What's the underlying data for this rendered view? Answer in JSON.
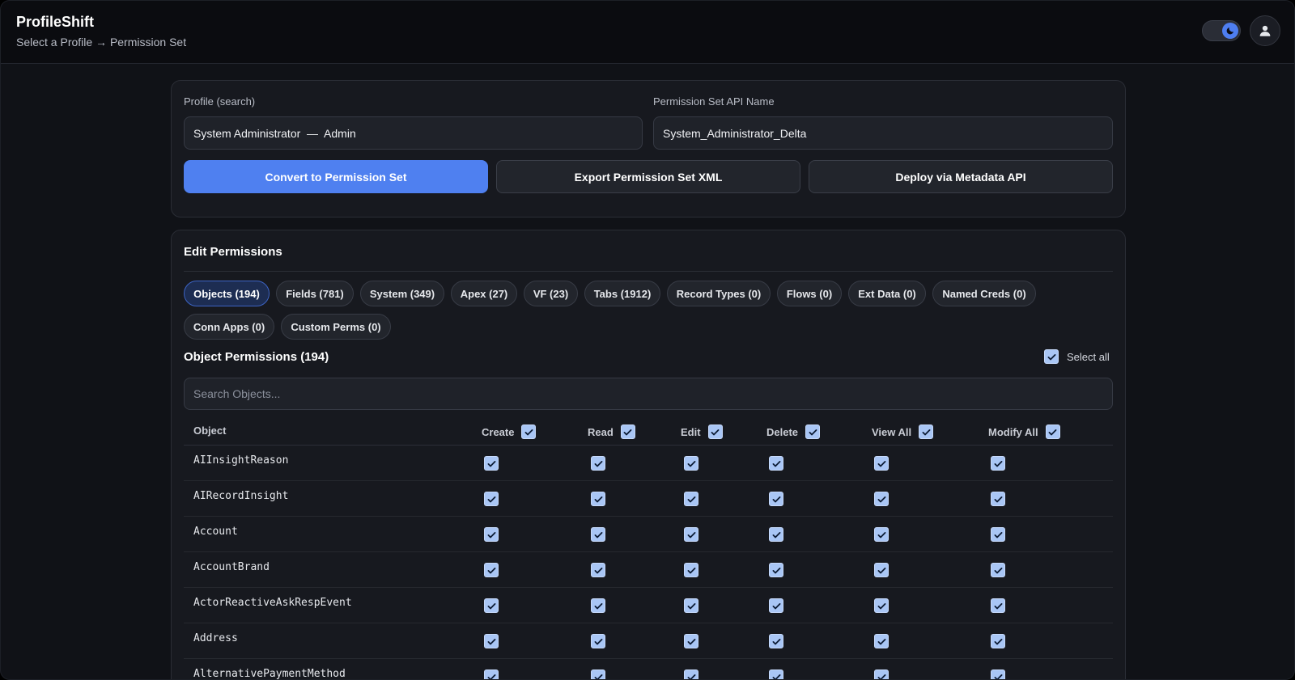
{
  "header": {
    "title": "ProfileShift",
    "subtitle": "Select a Profile → Permission Set"
  },
  "form": {
    "profile_label": "Profile (search)",
    "profile_value": "System Administrator  —  Admin",
    "apiname_label": "Permission Set API Name",
    "apiname_value": "System_Administrator_Delta",
    "convert_label": "Convert to Permission Set",
    "export_label": "Export Permission Set XML",
    "deploy_label": "Deploy via Metadata API"
  },
  "permissions": {
    "title": "Edit Permissions",
    "tabs": [
      {
        "label": "Objects (194)",
        "active": true
      },
      {
        "label": "Fields (781)"
      },
      {
        "label": "System (349)"
      },
      {
        "label": "Apex (27)"
      },
      {
        "label": "VF (23)"
      },
      {
        "label": "Tabs (1912)"
      },
      {
        "label": "Record Types (0)"
      },
      {
        "label": "Flows (0)"
      },
      {
        "label": "Ext Data (0)"
      },
      {
        "label": "Named Creds (0)"
      },
      {
        "label": "Conn Apps (0)"
      },
      {
        "label": "Custom Perms (0)"
      }
    ],
    "object_title": "Object Permissions (194)",
    "select_all_label": "Select all",
    "search_placeholder": "Search Objects...",
    "columns": {
      "object": "Object",
      "create": "Create",
      "read": "Read",
      "edit": "Edit",
      "delete": "Delete",
      "view_all": "View All",
      "modify_all": "Modify All"
    },
    "rows": [
      {
        "name": "AIInsightReason"
      },
      {
        "name": "AIRecordInsight"
      },
      {
        "name": "Account"
      },
      {
        "name": "AccountBrand"
      },
      {
        "name": "ActorReactiveAskRespEvent"
      },
      {
        "name": "Address"
      },
      {
        "name": "AlternativePaymentMethod"
      }
    ]
  },
  "colors": {
    "accent": "#4f80f0",
    "checkbox": "#a9c6f5",
    "background": "#101217"
  }
}
